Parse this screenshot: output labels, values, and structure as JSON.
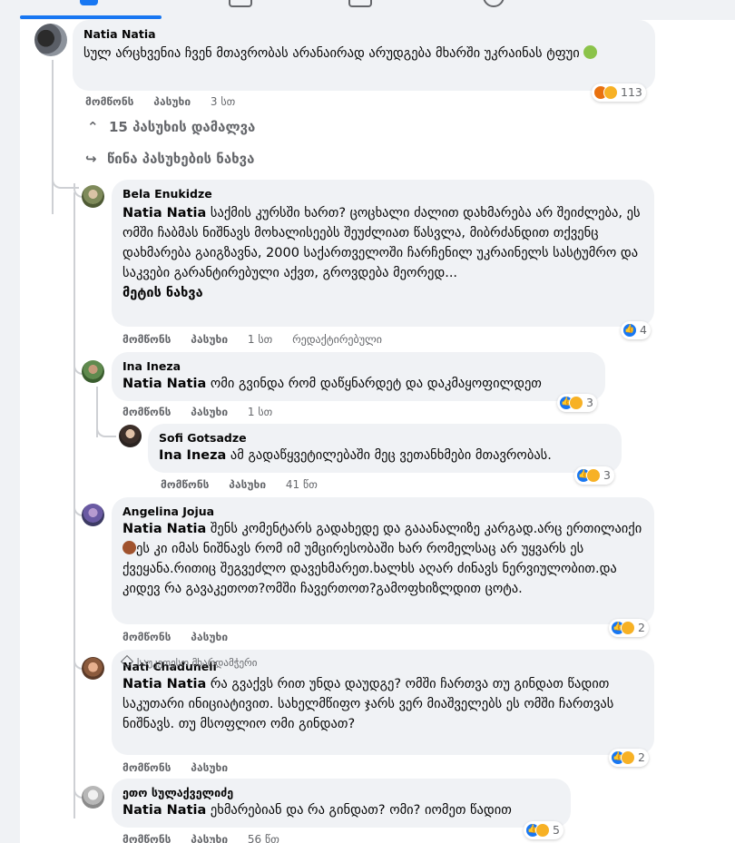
{
  "nav": {
    "tabs": [
      "home",
      "video",
      "marketplace",
      "groups"
    ],
    "active_color": "#1877f2"
  },
  "comments": [
    {
      "author": "Natia Natia",
      "text": "სულ არცხვენია ჩვენ მთავრობას არანაირად არუდგება მხარში უკრაინას ტფუი",
      "emoji_icon": "nauseated-face-icon",
      "like": "მომწონს",
      "reply": "პასუხი",
      "time": "3 სთ",
      "reaction_count": "113",
      "reactions": [
        "angry",
        "haha"
      ]
    }
  ],
  "thread_links": {
    "hide": "15 პასუხის დამალვა",
    "prev": "წინა პასუხების ნახვა"
  },
  "replies": [
    {
      "author": "Bela Enukidze",
      "mention": "Natia Natia",
      "text": " საქმის კურსში ხართ? ცოცხალი ძალით დახმარება არ შეიძლება, ეს ომში ჩაბმას ნიშნავს მოხალისეებს შეუძლიათ წასვლა, მიბრძანდით თქვენც დახმარება გაიგზავნა, 2000 საქართველოში ჩარჩენილ უკრაინელს სასტუმრო და საკვები გარანტირებული აქვთ, გროვდება მეორედ...",
      "see_more": "მეტის ნახვა",
      "like": "მომწონს",
      "reply": "პასუხი",
      "time": "1 სთ",
      "edited": "რედაქტირებული",
      "reaction_count": "4"
    },
    {
      "author": "Ina Ineza",
      "mention": "Natia Natia",
      "text": " ომი გვინდა რომ დაწყნარდეტ და დაკმაყოფილდეთ",
      "like": "მომწონს",
      "reply": "პასუხი",
      "time": "1 სთ",
      "reaction_count": "3"
    },
    {
      "author": "Sofi Gotsadze",
      "mention": "Ina Ineza",
      "text": " ამ გადაწყვეტილებაში მეც ვეთანხმები მთავრობას.",
      "like": "მომწონს",
      "reply": "პასუხი",
      "time": "41 წთ",
      "reaction_count": "3"
    },
    {
      "author": "Angelina Jojua",
      "mention": "Natia Natia",
      "text_a": " შენს კომენტარს გადახედე და გააანალიზე კარგად.არც ერთილაიქი ",
      "text_b": "ეს კი იმას ნიშნავს რომ იმ უმცირესობაში ხარ რომელსაც არ უყვარს ეს ქვეყანა.რითიც შეგვეძლო დავეხმარეთ.ხალხს აღარ ძინავს ნერვიულობით.და კიდევ რა გავაკეთოთ?ომში ჩავერთოთ?გამოფხიზლდით ცოტა.",
      "emoji_icon": "see-no-evil-monkey-icon",
      "like": "მომწონს",
      "reply": "პასუხი",
      "reaction_count": "2"
    },
    {
      "badge": "საუკეთესო მხარდამჭერი",
      "author": "Nati Chaduneli",
      "mention": "Natia Natia",
      "text": " რა გვაქვს რით უნდა დაუდგე? ომში ჩართვა თუ გინდათ წადით საკუთარი ინიციატივით. სახელმწიფო ჯარს ვერ მიაშველებს ეს ომში ჩართვას ნიშნავს. თუ მსოფლიო ომი გინდათ?",
      "like": "მომწონს",
      "reply": "პასუხი",
      "reaction_count": "2"
    },
    {
      "author": "ეთო სულაქველიძე",
      "mention": "Natia Natia",
      "text": " ეხმარებიან და რა გინდათ? ომი? იომეთ წადით",
      "like": "მომწონს",
      "reply": "პასუხი",
      "time": "56 წთ",
      "reaction_count": "5"
    }
  ]
}
